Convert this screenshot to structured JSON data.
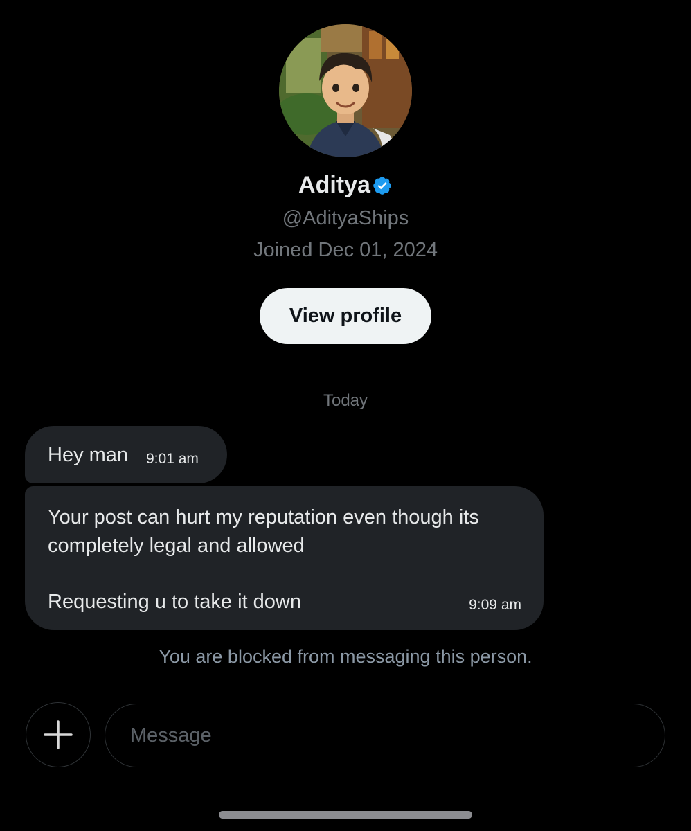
{
  "profile": {
    "display_name": "Aditya",
    "handle": "@AdityaShips",
    "joined": "Joined Dec 01, 2024",
    "view_profile_label": "View profile",
    "avatar_icon": "avatar-illustration",
    "verified_icon": "verified-badge-icon",
    "verified_color": "#1d9bf0"
  },
  "conversation": {
    "date_divider": "Today",
    "messages": [
      {
        "lines": [
          "Hey man"
        ],
        "time": "9:01 am"
      },
      {
        "lines": [
          "Your post can hurt my reputation even though its",
          "completely legal and allowed",
          "Requesting u to take it down"
        ],
        "time": "9:09 am"
      }
    ],
    "blocked_notice": "You are blocked from messaging this person."
  },
  "composer": {
    "add_icon": "plus-icon",
    "placeholder": "Message",
    "value": ""
  },
  "colors": {
    "background": "#000000",
    "bubble": "#202327",
    "button_bg": "#eff3f4",
    "muted_text": "#71767b"
  }
}
